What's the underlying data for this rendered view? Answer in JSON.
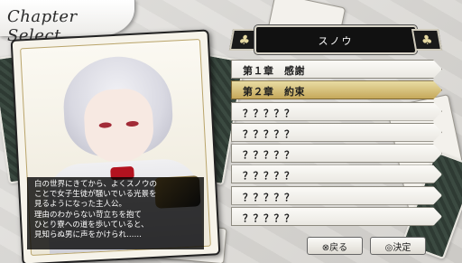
{
  "title": "Chapter Select",
  "character": {
    "name": "スノウ"
  },
  "description": {
    "lines": [
      "白の世界にきてから、よくスノウの",
      "ことで女子生徒が騒いでいる光景を",
      "見るようになった主人公。",
      "理由のわからない苛立ちを抱て",
      "ひとり寮への道を歩いていると、",
      "見知らぬ男に声をかけられ……"
    ]
  },
  "chapters": [
    {
      "label": "第１章　感謝",
      "selected": false
    },
    {
      "label": "第２章　約束",
      "selected": true
    },
    {
      "label": "？？？？？",
      "selected": false
    },
    {
      "label": "？？？？？",
      "selected": false
    },
    {
      "label": "？？？？？",
      "selected": false
    },
    {
      "label": "？？？？？",
      "selected": false
    },
    {
      "label": "？？？？？",
      "selected": false
    },
    {
      "label": "？？？？？",
      "selected": false
    }
  ],
  "buttons": {
    "back": "⊗戻る",
    "ok": "◎決定"
  },
  "tab_icons": {
    "left": "♣",
    "right": "♣"
  },
  "colors": {
    "selected_chapter": "#c5a85a",
    "name_plate": "#111111"
  }
}
